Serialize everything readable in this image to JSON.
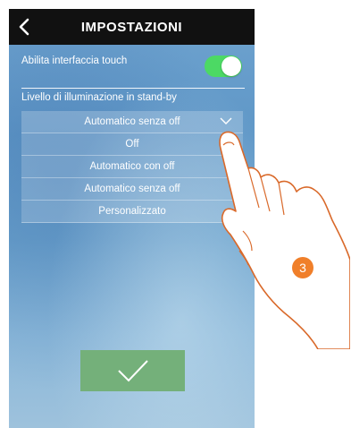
{
  "header": {
    "title": "IMPOSTAZIONI",
    "back_icon": "chevron-left-icon"
  },
  "touch_setting": {
    "label": "Abilita interfaccia touch",
    "enabled": true,
    "toggle_color": "#4cd964"
  },
  "standby": {
    "label": "Livello di illuminazione in stand-by",
    "selected": "Automatico senza off",
    "options": [
      "Off",
      "Automatico con off",
      "Automatico senza off",
      "Personalizzato"
    ]
  },
  "confirm": {
    "icon": "checkmark-icon",
    "color": "#74b07a"
  },
  "annotation": {
    "step": "3",
    "color": "#f07f2a"
  }
}
